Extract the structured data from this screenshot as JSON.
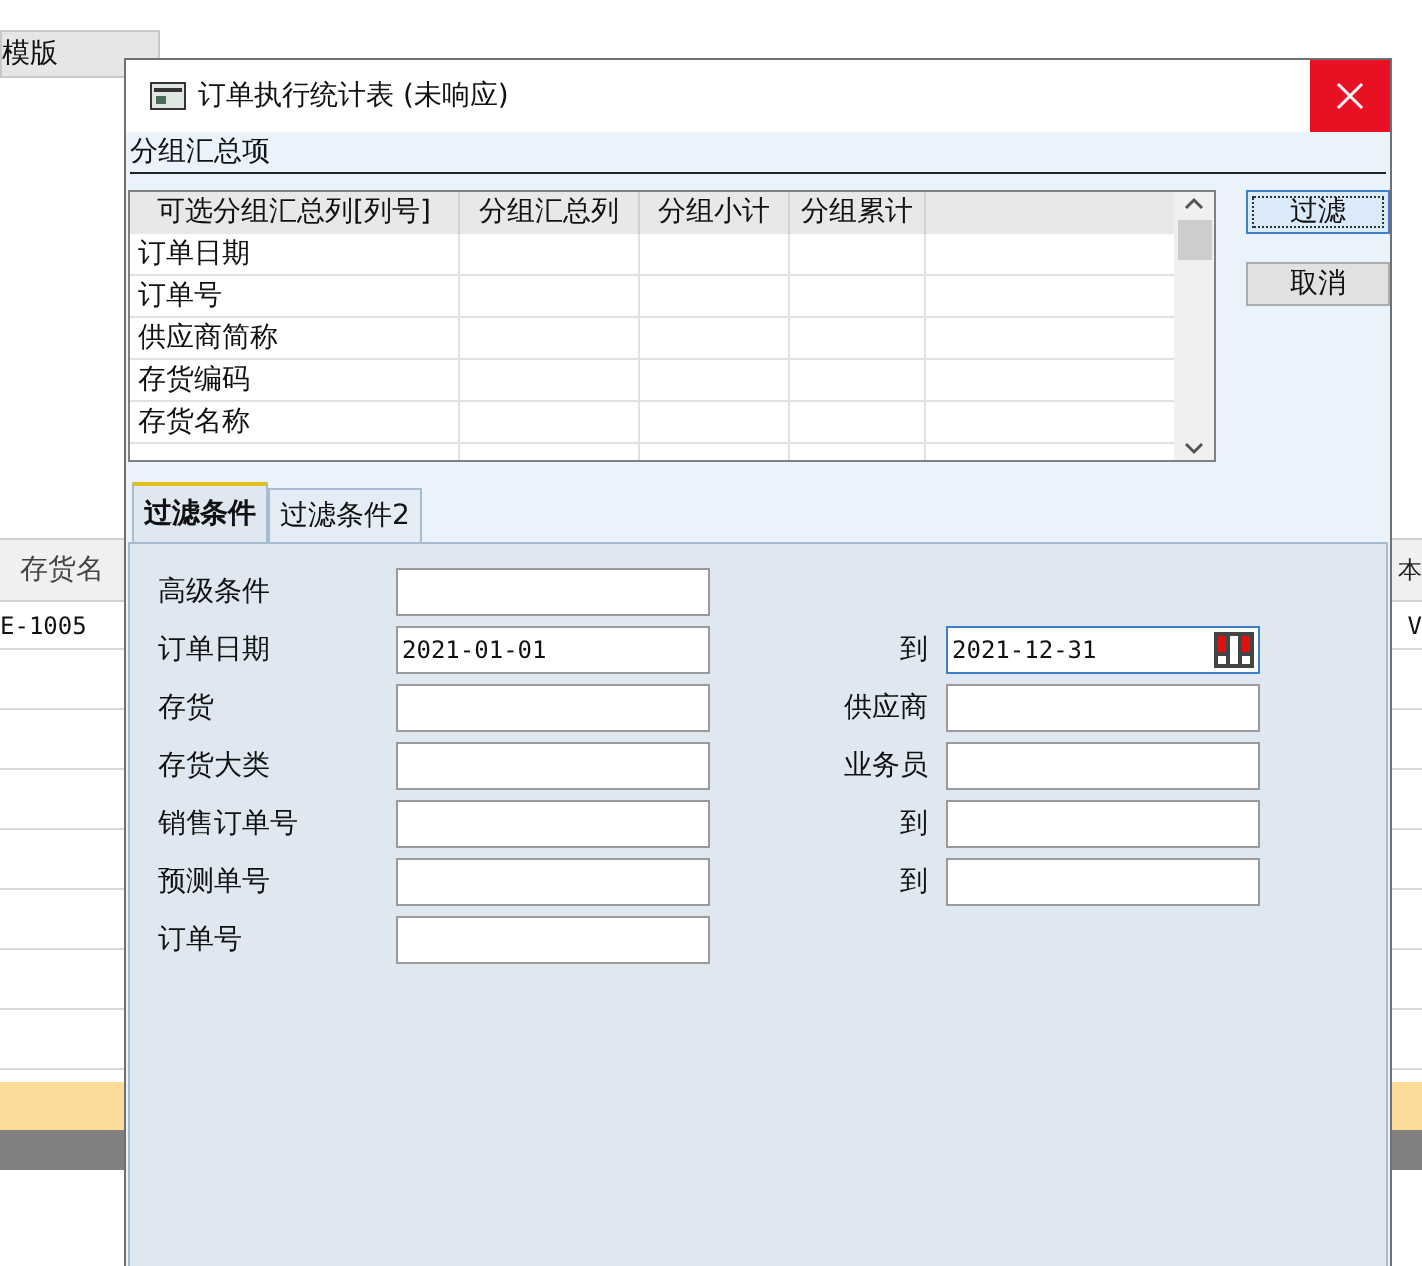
{
  "background": {
    "template_dropdown": "模版",
    "column_header": "存货名",
    "cell": "E-1005",
    "right_header": "本",
    "right_cell": "V"
  },
  "dialog": {
    "title": "订单执行统计表 (未响应)",
    "group_section": {
      "label": "分组汇总项",
      "columns": [
        "可选分组汇总列[列号]",
        "分组汇总列",
        "分组小计",
        "分组累计"
      ],
      "rows": [
        [
          "订单日期",
          null,
          null,
          null
        ],
        [
          "订单号",
          null,
          null,
          null
        ],
        [
          "供应商简称",
          null,
          null,
          null
        ],
        [
          "存货编码",
          null,
          null,
          null
        ],
        [
          "存货名称",
          null,
          null,
          null
        ]
      ]
    },
    "buttons": [
      {
        "label": "过滤",
        "focused": true
      },
      {
        "label": "取消",
        "focused": false
      }
    ],
    "tabs": [
      {
        "label": "过滤条件",
        "selected": true
      },
      {
        "label": "过滤条件2",
        "selected": false
      }
    ],
    "form": [
      {
        "left": {
          "label": "高级条件"
        }
      },
      {
        "left": {
          "label": "订单日期",
          "value": "2021-01-01"
        },
        "right": {
          "label": "到",
          "value": "2021-12-31",
          "kind": "date"
        }
      },
      {
        "left": {
          "label": "存货"
        },
        "right": {
          "label": "供应商",
          "kind": "text"
        }
      },
      {
        "left": {
          "label": "存货大类"
        },
        "right": {
          "label": "业务员",
          "kind": "text"
        }
      },
      {
        "left": {
          "label": "销售订单号"
        },
        "right": {
          "label": "到",
          "kind": "text"
        }
      },
      {
        "left": {
          "label": "预测单号"
        },
        "right": {
          "label": "到",
          "kind": "text"
        }
      },
      {
        "left": {
          "label": "订单号"
        }
      }
    ]
  }
}
